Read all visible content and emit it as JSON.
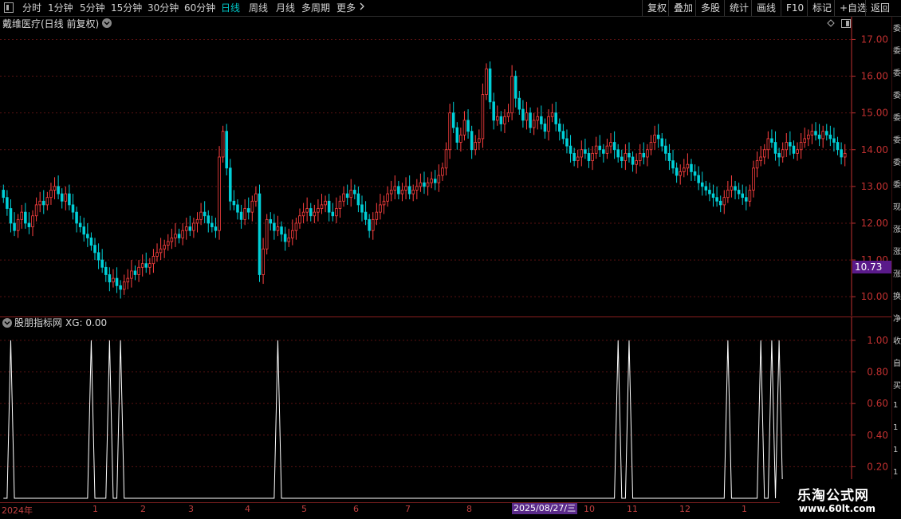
{
  "toolbar": {
    "periods": [
      "分时",
      "1分钟",
      "5分钟",
      "15分钟",
      "30分钟",
      "60分钟",
      "日线",
      "周线",
      "月线",
      "多周期",
      "更多"
    ],
    "active_period": "日线",
    "right_buttons": [
      "复权",
      "叠加",
      "多股",
      "统计",
      "画线",
      "F10",
      "标记",
      "+自选",
      "返回"
    ]
  },
  "main_panel": {
    "title": "戴维医疗(日线 前复权)",
    "current_price_label": "10.73"
  },
  "indicator_panel": {
    "title": "股朋指标网",
    "value_label": "XG: 0.00"
  },
  "xaxis": {
    "labels": [
      "2024年",
      "1",
      "2",
      "3",
      "4",
      "5",
      "6",
      "7",
      "8",
      "10",
      "11",
      "12",
      "1"
    ],
    "cursor_date": "2025/08/27/三"
  },
  "right_strip_chars": [
    "委",
    "委",
    "委",
    "委",
    "委",
    "委",
    "委",
    "委",
    "现",
    "涨",
    "涨",
    "涨",
    "换",
    "净",
    "收",
    "自",
    "买",
    "1",
    "1",
    "1",
    "1",
    "1"
  ],
  "watermark": {
    "title": "乐淘公式网",
    "url": "www.60lt.com"
  },
  "colors": {
    "up": "#ff4040",
    "down": "#00d0d8",
    "grid": "#5a1212",
    "axis": "#c03030",
    "signal": "#ffffff",
    "price_tag": "#5a1a8a"
  },
  "chart_data": [
    {
      "type": "candlestick",
      "title": "戴维医疗(日线 前复权)",
      "ylim": [
        9.7,
        17.4
      ],
      "y_ticks": [
        10.0,
        11.0,
        12.0,
        13.0,
        14.0,
        15.0,
        16.0,
        17.0
      ],
      "x_labels": [
        "2024年",
        "1",
        "2",
        "3",
        "4",
        "5",
        "6",
        "7",
        "8",
        "10",
        "11",
        "12",
        "1"
      ],
      "cursor_date": "2025/08/27/三",
      "values": [
        12.7,
        12.4,
        12.0,
        11.8,
        12.1,
        12.3,
        12.0,
        11.9,
        12.2,
        12.5,
        12.6,
        12.5,
        12.7,
        12.9,
        13.0,
        12.8,
        12.6,
        12.8,
        12.5,
        12.3,
        12.0,
        11.9,
        11.7,
        11.6,
        11.4,
        11.2,
        11.0,
        10.8,
        10.6,
        10.4,
        10.5,
        10.3,
        10.2,
        10.4,
        10.5,
        10.7,
        10.6,
        10.8,
        10.9,
        10.8,
        10.9,
        11.1,
        11.2,
        11.3,
        11.4,
        11.5,
        11.6,
        11.7,
        11.6,
        11.8,
        11.9,
        11.8,
        12.0,
        12.1,
        12.3,
        12.2,
        12.0,
        11.9,
        11.8,
        13.8,
        14.5,
        13.5,
        12.6,
        12.5,
        12.3,
        12.1,
        12.4,
        12.3,
        12.6,
        12.8,
        10.6,
        11.3,
        12.1,
        12.0,
        11.8,
        11.9,
        11.7,
        11.5,
        11.6,
        11.8,
        12.0,
        12.2,
        12.3,
        12.4,
        12.2,
        12.3,
        12.4,
        12.5,
        12.6,
        12.3,
        12.2,
        12.4,
        12.6,
        12.8,
        12.7,
        12.9,
        12.8,
        12.5,
        12.3,
        12.1,
        11.8,
        12.1,
        12.3,
        12.5,
        12.6,
        12.8,
        12.9,
        13.0,
        12.8,
        12.9,
        13.0,
        12.8,
        12.9,
        13.0,
        13.1,
        13.0,
        13.1,
        13.2,
        13.1,
        13.3,
        13.5,
        14.0,
        15.0,
        14.6,
        14.2,
        14.4,
        14.8,
        14.5,
        14.0,
        14.2,
        14.3,
        15.5,
        16.2,
        15.3,
        14.8,
        14.9,
        14.7,
        14.9,
        15.0,
        16.0,
        15.4,
        15.1,
        14.8,
        15.0,
        14.6,
        14.8,
        14.9,
        14.7,
        14.5,
        14.9,
        15.0,
        14.7,
        14.5,
        14.3,
        14.1,
        13.9,
        13.7,
        13.8,
        14.0,
        13.9,
        13.7,
        13.9,
        14.1,
        14.0,
        13.9,
        14.1,
        14.2,
        14.0,
        13.8,
        13.7,
        13.9,
        13.8,
        13.6,
        13.7,
        13.9,
        13.8,
        14.0,
        14.2,
        14.4,
        14.3,
        14.1,
        13.9,
        13.7,
        13.5,
        13.3,
        13.4,
        13.5,
        13.6,
        13.4,
        13.3,
        13.1,
        13.0,
        12.9,
        12.8,
        12.7,
        12.6,
        12.5,
        12.7,
        12.9,
        13.0,
        12.9,
        12.8,
        12.7,
        12.6,
        12.9,
        13.5,
        13.7,
        13.8,
        14.0,
        14.3,
        14.2,
        13.9,
        13.8,
        14.0,
        14.2,
        14.1,
        13.9,
        14.0,
        14.2,
        14.3,
        14.4,
        14.5,
        14.4,
        14.3,
        14.5,
        14.4,
        14.3,
        14.2,
        14.0,
        13.8,
        13.9
      ]
    },
    {
      "type": "line",
      "series": [
        {
          "name": "XG"
        }
      ],
      "ylim": [
        0,
        1.05
      ],
      "y_ticks": [
        0.2,
        0.4,
        0.6,
        0.8,
        1.0
      ],
      "signal_indices": [
        2,
        24,
        29,
        32,
        75,
        168,
        171,
        198,
        207,
        210,
        212
      ]
    }
  ]
}
